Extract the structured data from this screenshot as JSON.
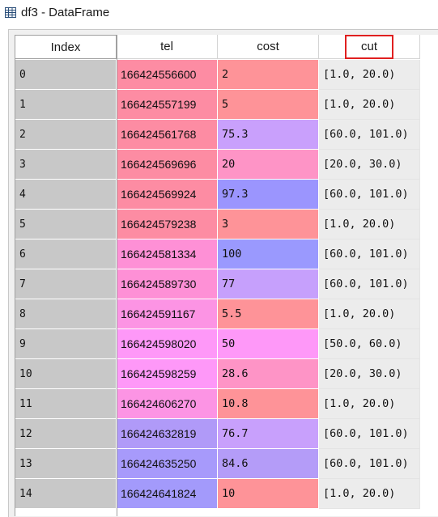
{
  "window": {
    "title": "df3 - DataFrame",
    "icon": "table-grid-icon"
  },
  "table": {
    "columns": [
      {
        "key": "index",
        "label": "Index"
      },
      {
        "key": "tel",
        "label": "tel"
      },
      {
        "key": "cost",
        "label": "cost"
      },
      {
        "key": "cut",
        "label": "cut",
        "highlighted": true,
        "highlight_color": "#e02020"
      }
    ],
    "rows": [
      {
        "index": "0",
        "tel": "166424556600",
        "cost": "2",
        "cut": "[1.0, 20.0)",
        "tel_color": "#fd8ca3",
        "cost_color": "#fe9398"
      },
      {
        "index": "1",
        "tel": "166424557199",
        "cost": "5",
        "cut": "[1.0, 20.0)",
        "tel_color": "#fd8ca3",
        "cost_color": "#fe9398"
      },
      {
        "index": "2",
        "tel": "166424561768",
        "cost": "75.3",
        "cut": "[60.0, 101.0)",
        "tel_color": "#fd8ca3",
        "cost_color": "#c9a0fc"
      },
      {
        "index": "3",
        "tel": "166424569696",
        "cost": "20",
        "cut": "[20.0, 30.0)",
        "tel_color": "#fd8ca3",
        "cost_color": "#fe94c6"
      },
      {
        "index": "4",
        "tel": "166424569924",
        "cost": "97.3",
        "cut": "[60.0, 101.0)",
        "tel_color": "#fd8ca3",
        "cost_color": "#9b95fe"
      },
      {
        "index": "5",
        "tel": "166424579238",
        "cost": "3",
        "cut": "[1.0, 20.0)",
        "tel_color": "#fd8ca3",
        "cost_color": "#fe9398"
      },
      {
        "index": "6",
        "tel": "166424581334",
        "cost": "100",
        "cut": "[60.0, 101.0)",
        "tel_color": "#fe90d6",
        "cost_color": "#9a99fe"
      },
      {
        "index": "7",
        "tel": "166424589730",
        "cost": "77",
        "cut": "[60.0, 101.0)",
        "tel_color": "#fe90d6",
        "cost_color": "#c6a0fc"
      },
      {
        "index": "8",
        "tel": "166424591167",
        "cost": "5.5",
        "cut": "[1.0, 20.0)",
        "tel_color": "#fc94e4",
        "cost_color": "#fe9398"
      },
      {
        "index": "9",
        "tel": "166424598020",
        "cost": "50",
        "cut": "[50.0, 60.0)",
        "tel_color": "#fe98f8",
        "cost_color": "#fe98f8"
      },
      {
        "index": "10",
        "tel": "166424598259",
        "cost": "28.6",
        "cut": "[20.0, 30.0)",
        "tel_color": "#fe98f8",
        "cost_color": "#fe94c6"
      },
      {
        "index": "11",
        "tel": "166424606270",
        "cost": "10.8",
        "cut": "[1.0, 20.0)",
        "tel_color": "#fc94e4",
        "cost_color": "#fe9398"
      },
      {
        "index": "12",
        "tel": "166424632819",
        "cost": "76.7",
        "cut": "[60.0, 101.0)",
        "tel_color": "#b09af8",
        "cost_color": "#c8a0fc"
      },
      {
        "index": "13",
        "tel": "166424635250",
        "cost": "84.6",
        "cut": "[60.0, 101.0)",
        "tel_color": "#a79afb",
        "cost_color": "#b49cf8"
      },
      {
        "index": "14",
        "tel": "166424641824",
        "cost": "10",
        "cut": "[1.0, 20.0)",
        "tel_color": "#a39afb",
        "cost_color": "#fe9398"
      }
    ]
  }
}
